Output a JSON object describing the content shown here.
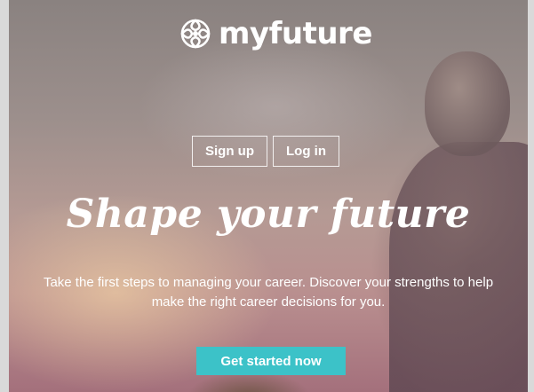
{
  "brand": {
    "name": "myfuture",
    "logo_icon": "rosette-figure-icon"
  },
  "auth": {
    "signup_label": "Sign up",
    "login_label": "Log in"
  },
  "hero": {
    "headline": "Shape your future",
    "subtitle_line1": "Take the first steps to managing your career. Discover your strengths to help",
    "subtitle_line2": "make the right career decisions for you.",
    "cta_label": "Get started now"
  },
  "colors": {
    "cta_background": "#3cc2c8",
    "page_background": "#d9d9d9"
  }
}
